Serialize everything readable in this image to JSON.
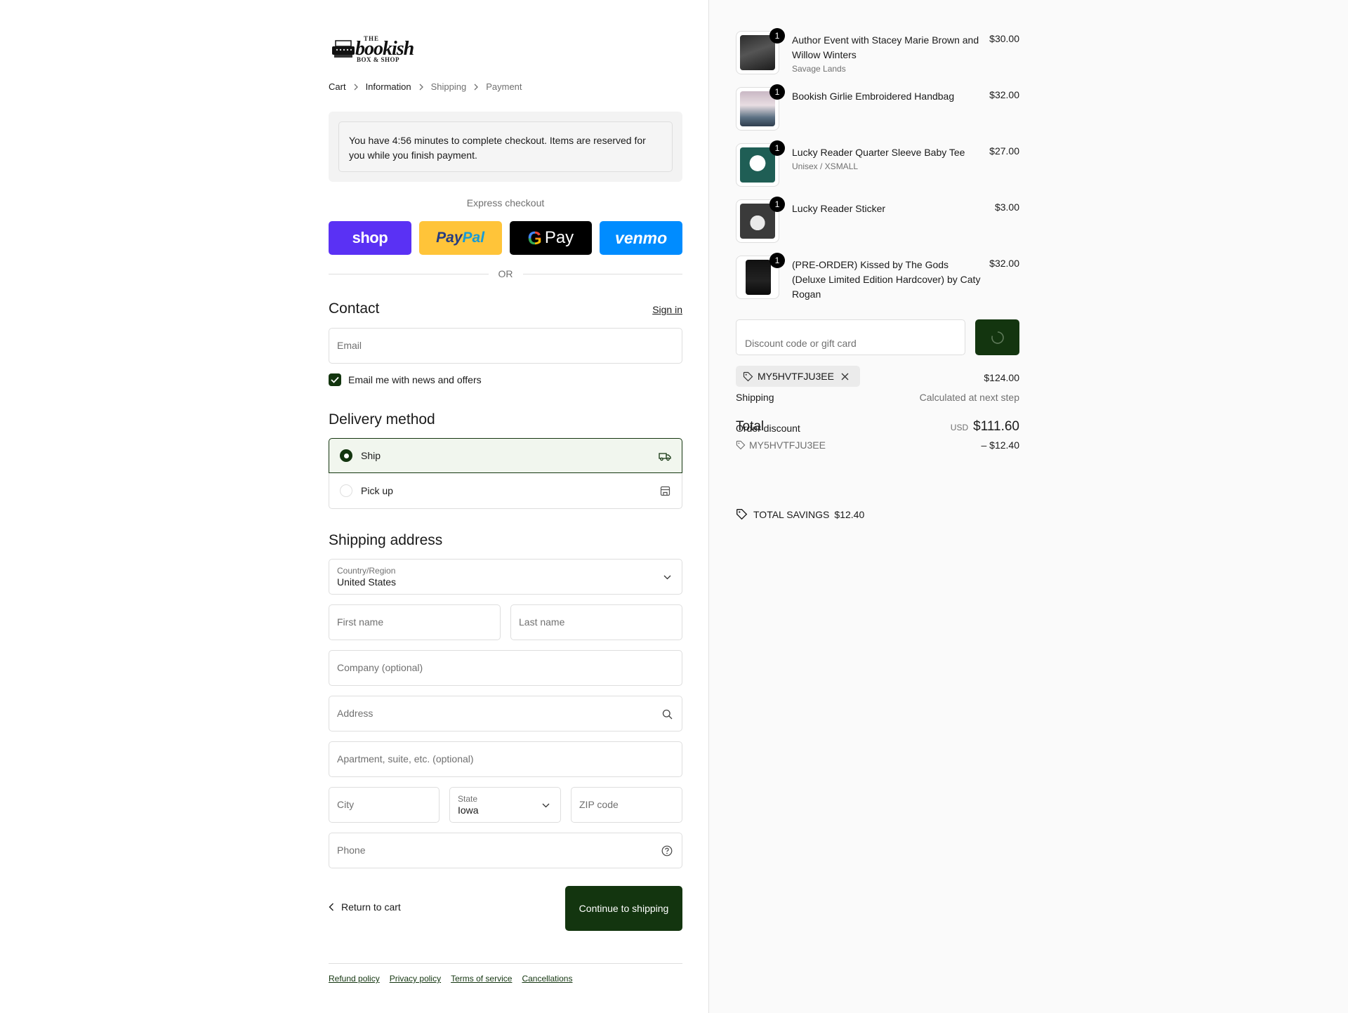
{
  "logo": {
    "top": "THE",
    "main": "bookish",
    "sub": "BOX & SHOP"
  },
  "breadcrumb": [
    "Cart",
    "Information",
    "Shipping",
    "Payment"
  ],
  "timer_text": "You have 4:56 minutes to complete checkout. Items are reserved for you while you finish payment.",
  "express": {
    "label": "Express checkout",
    "shop": "shop",
    "paypal_1": "Pay",
    "paypal_2": "Pal",
    "gpay_g": "G",
    "gpay": "Pay",
    "venmo": "venmo"
  },
  "or_text": "OR",
  "contact": {
    "title": "Contact",
    "signin": "Sign in",
    "email_placeholder": "Email",
    "newsletter": "Email me with news and offers"
  },
  "delivery": {
    "title": "Delivery method",
    "ship": "Ship",
    "pickup": "Pick up"
  },
  "shipping": {
    "title": "Shipping address",
    "country_label": "Country/Region",
    "country_value": "United States",
    "first_name": "First name",
    "last_name": "Last name",
    "company": "Company (optional)",
    "address": "Address",
    "apartment": "Apartment, suite, etc. (optional)",
    "city": "City",
    "state_label": "State",
    "state_value": "Iowa",
    "zip": "ZIP code",
    "phone": "Phone"
  },
  "actions": {
    "return": "Return to cart",
    "continue": "Continue to shipping"
  },
  "footer": [
    "Refund policy",
    "Privacy policy",
    "Terms of service",
    "Cancellations"
  ],
  "items": [
    {
      "qty": "1",
      "name": "Author Event with Stacey Marie Brown and Willow Winters",
      "variant": "Savage Lands",
      "price": "$30.00"
    },
    {
      "qty": "1",
      "name": "Bookish Girlie Embroidered Handbag",
      "variant": "",
      "price": "$32.00"
    },
    {
      "qty": "1",
      "name": "Lucky Reader Quarter Sleeve Baby Tee",
      "variant": "Unisex / XSMALL",
      "price": "$27.00"
    },
    {
      "qty": "1",
      "name": "Lucky Reader Sticker",
      "variant": "",
      "price": "$3.00"
    },
    {
      "qty": "1",
      "name": "(PRE-ORDER) Kissed by The Gods (Deluxe Limited Edition Hardcover) by Caty Rogan",
      "variant": "",
      "price": "$32.00"
    }
  ],
  "discount": {
    "placeholder": "Discount code or gift card",
    "code": "MY5HVTFJU3EE"
  },
  "summary": {
    "subtotal": "$124.00",
    "shipping_label": "Shipping",
    "shipping_value": "Calculated at next step",
    "total_label": "Total",
    "order_discount_label": "Order discount",
    "currency": "USD",
    "total": "$111.60",
    "discount_code": "MY5HVTFJU3EE",
    "discount_amount": "– $12.40",
    "savings_label": "TOTAL SAVINGS",
    "savings_amount": "$12.40"
  },
  "colors": {
    "accent": "#13350f",
    "shop": "#5a31f4",
    "paypal": "#ffc439",
    "venmo": "#008cff"
  }
}
